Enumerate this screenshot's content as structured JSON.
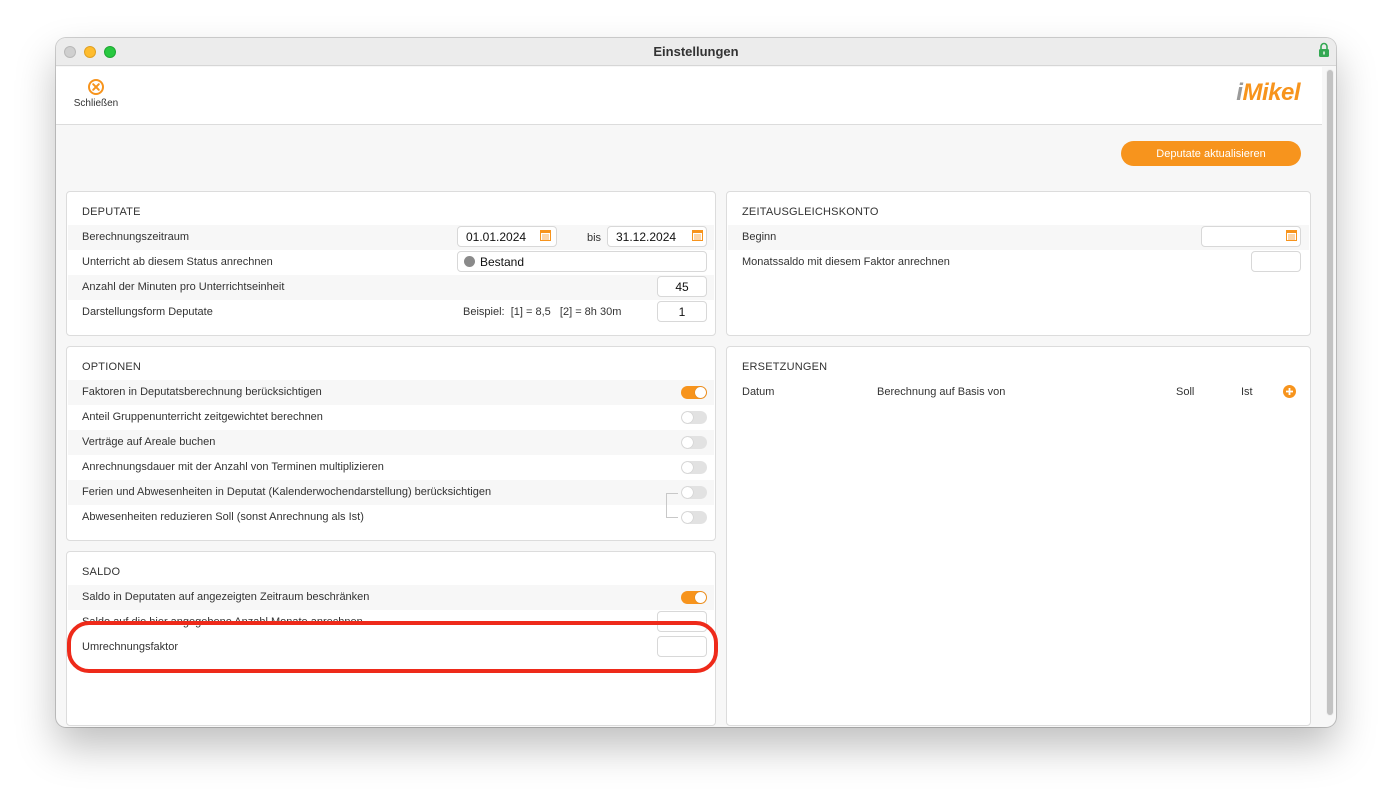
{
  "window": {
    "title": "Einstellungen"
  },
  "toolbar": {
    "close_label": "Schließen",
    "logo_prefix": "i",
    "logo_text": "Mikel"
  },
  "actions": {
    "update_button": "Deputate aktualisieren"
  },
  "deputate": {
    "title": "DEPUTATE",
    "period_label": "Berechnungszeitraum",
    "period_from": "01.01.2024",
    "period_to_label": "bis",
    "period_to": "31.12.2024",
    "status_label": "Unterricht ab diesem Status anrechnen",
    "status_value": "Bestand",
    "minutes_label": "Anzahl der Minuten pro Unterrichtseinheit",
    "minutes_value": "45",
    "format_label": "Darstellungsform Deputate",
    "format_hint": "Beispiel:  [1] = 8,5   [2] = 8h 30m",
    "format_value": "1"
  },
  "zeitausgleich": {
    "title": "ZEITAUSGLEICHSKONTO",
    "begin_label": "Beginn",
    "begin_value": "",
    "factor_label": "Monatssaldo mit diesem Faktor anrechnen",
    "factor_value": ""
  },
  "optionen": {
    "title": "OPTIONEN",
    "items": [
      {
        "label": "Faktoren in Deputatsberechnung berücksichtigen",
        "on": true
      },
      {
        "label": "Anteil Gruppenunterricht zeitgewichtet berechnen",
        "on": false
      },
      {
        "label": "Verträge auf Areale buchen",
        "on": false
      },
      {
        "label": "Anrechnungsdauer mit der Anzahl von Terminen multiplizieren",
        "on": false
      },
      {
        "label": "Ferien und Abwesenheiten in Deputat (Kalenderwochendarstellung) berücksichtigen",
        "on": false
      },
      {
        "label": "Abwesenheiten reduzieren Soll (sonst Anrechnung als Ist)",
        "on": false
      }
    ]
  },
  "ersetzungen": {
    "title": "ERSETZUNGEN",
    "col_date": "Datum",
    "col_basis": "Berechnung auf Basis von",
    "col_soll": "Soll",
    "col_ist": "Ist"
  },
  "saldo": {
    "title": "SALDO",
    "limit_label": "Saldo in Deputaten auf angezeigten Zeitraum beschränken",
    "limit_on": true,
    "months_label": "Saldo auf die hier angegebene Anzahl Monate anrechnen",
    "months_value": "",
    "factor_label": "Umrechnungsfaktor",
    "factor_value": ""
  },
  "colors": {
    "accent": "#f7941d",
    "highlight": "#ee2a1a"
  }
}
